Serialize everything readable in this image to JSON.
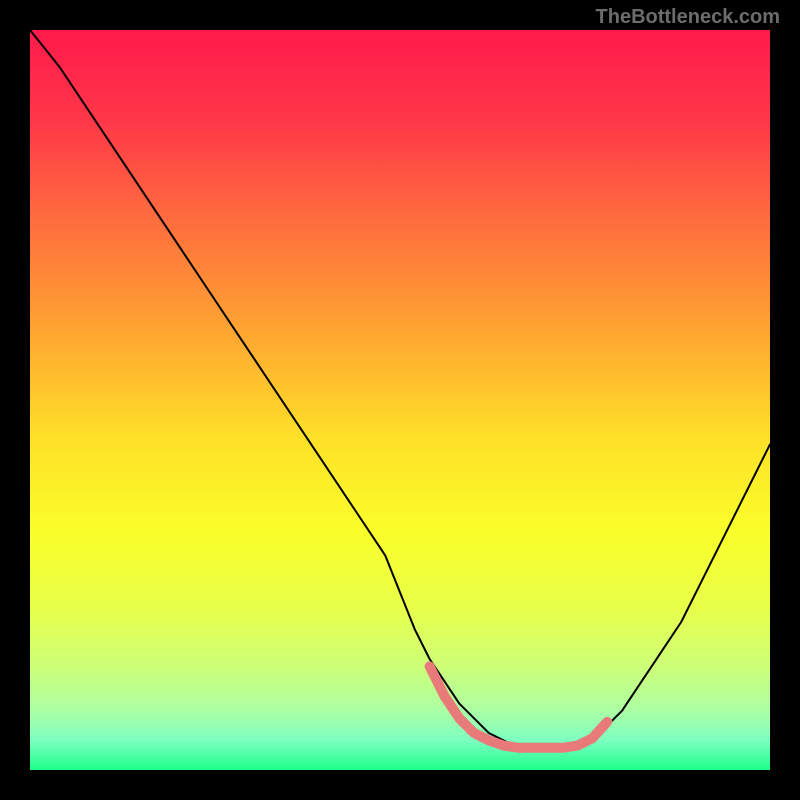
{
  "watermark": {
    "text": "TheBottleneck.com"
  },
  "chart_data": {
    "type": "line",
    "title": "",
    "xlabel": "",
    "ylabel": "",
    "xlim": [
      0,
      100
    ],
    "ylim": [
      0,
      100
    ],
    "grid": false,
    "legend": false,
    "background_gradient_stops": [
      {
        "pct": 0,
        "color": "#ff1a4b"
      },
      {
        "pct": 12,
        "color": "#ff3648"
      },
      {
        "pct": 25,
        "color": "#ff6a3e"
      },
      {
        "pct": 40,
        "color": "#ffa232"
      },
      {
        "pct": 55,
        "color": "#ffe028"
      },
      {
        "pct": 68,
        "color": "#faff2a"
      },
      {
        "pct": 78,
        "color": "#e8ff4a"
      },
      {
        "pct": 86,
        "color": "#cdff78"
      },
      {
        "pct": 92,
        "color": "#acffa4"
      },
      {
        "pct": 96,
        "color": "#7dffc0"
      },
      {
        "pct": 100,
        "color": "#1dff8a"
      }
    ],
    "series": [
      {
        "name": "bottleneck-curve",
        "stroke": "#000000",
        "x": [
          0,
          4,
          8,
          12,
          16,
          20,
          24,
          28,
          32,
          36,
          40,
          44,
          48,
          52,
          54,
          56,
          58,
          60,
          62,
          64,
          66,
          68,
          70,
          72,
          74,
          76,
          78,
          80,
          82,
          84,
          86,
          88,
          90,
          92,
          94,
          96,
          98,
          100
        ],
        "y": [
          100,
          95,
          89,
          83,
          77,
          71,
          65,
          59,
          53,
          47,
          41,
          35,
          29,
          19,
          15,
          12,
          9,
          7,
          5,
          4,
          3,
          3,
          3,
          3,
          3,
          4,
          6,
          8,
          11,
          14,
          17,
          20,
          24,
          28,
          32,
          36,
          40,
          44
        ]
      },
      {
        "name": "optimum-band",
        "stroke": "#e97a7a",
        "stroke_width": 10,
        "x": [
          54,
          56,
          58,
          60,
          62,
          64,
          66,
          68,
          70,
          72,
          74,
          76,
          78
        ],
        "y": [
          14,
          10,
          7,
          5,
          4,
          3.3,
          3,
          3,
          3,
          3,
          3.3,
          4.3,
          6.5
        ]
      }
    ]
  }
}
